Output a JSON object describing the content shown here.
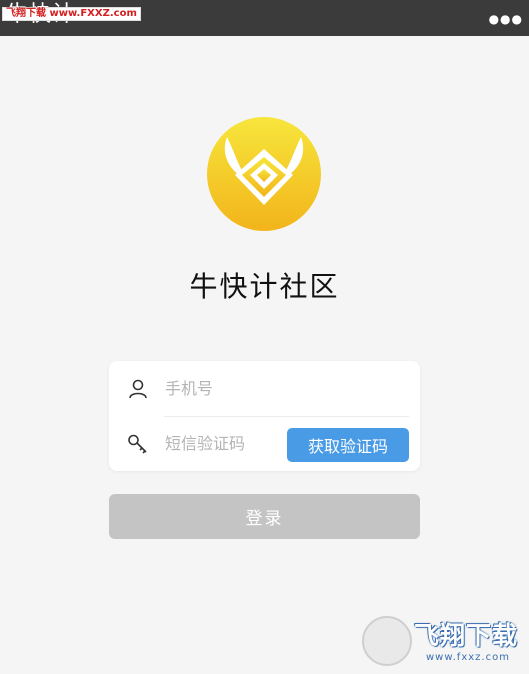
{
  "topbar": {
    "title": "牛快计",
    "watermark": "飞翔下载 www.FXXZ.com",
    "more_icon": "ellipsis-icon",
    "background": "#3b3b3b"
  },
  "logo": {
    "icon": "bull-horn-diamond-logo",
    "gradient_top": "#f7e33a",
    "gradient_bottom": "#f3b81b"
  },
  "app_name": "牛快计社区",
  "login_form": {
    "phone": {
      "icon": "user-icon",
      "placeholder": "手机号",
      "value": ""
    },
    "code": {
      "icon": "key-icon",
      "placeholder": "短信验证码",
      "value": ""
    },
    "get_code_label": "获取验证码",
    "get_code_color": "#4a9be6"
  },
  "login_button": {
    "label": "登录",
    "color": "#c4c4c4"
  },
  "watermark_bottom": {
    "text": "飞翔下载",
    "url": "www.fxxz.com"
  }
}
